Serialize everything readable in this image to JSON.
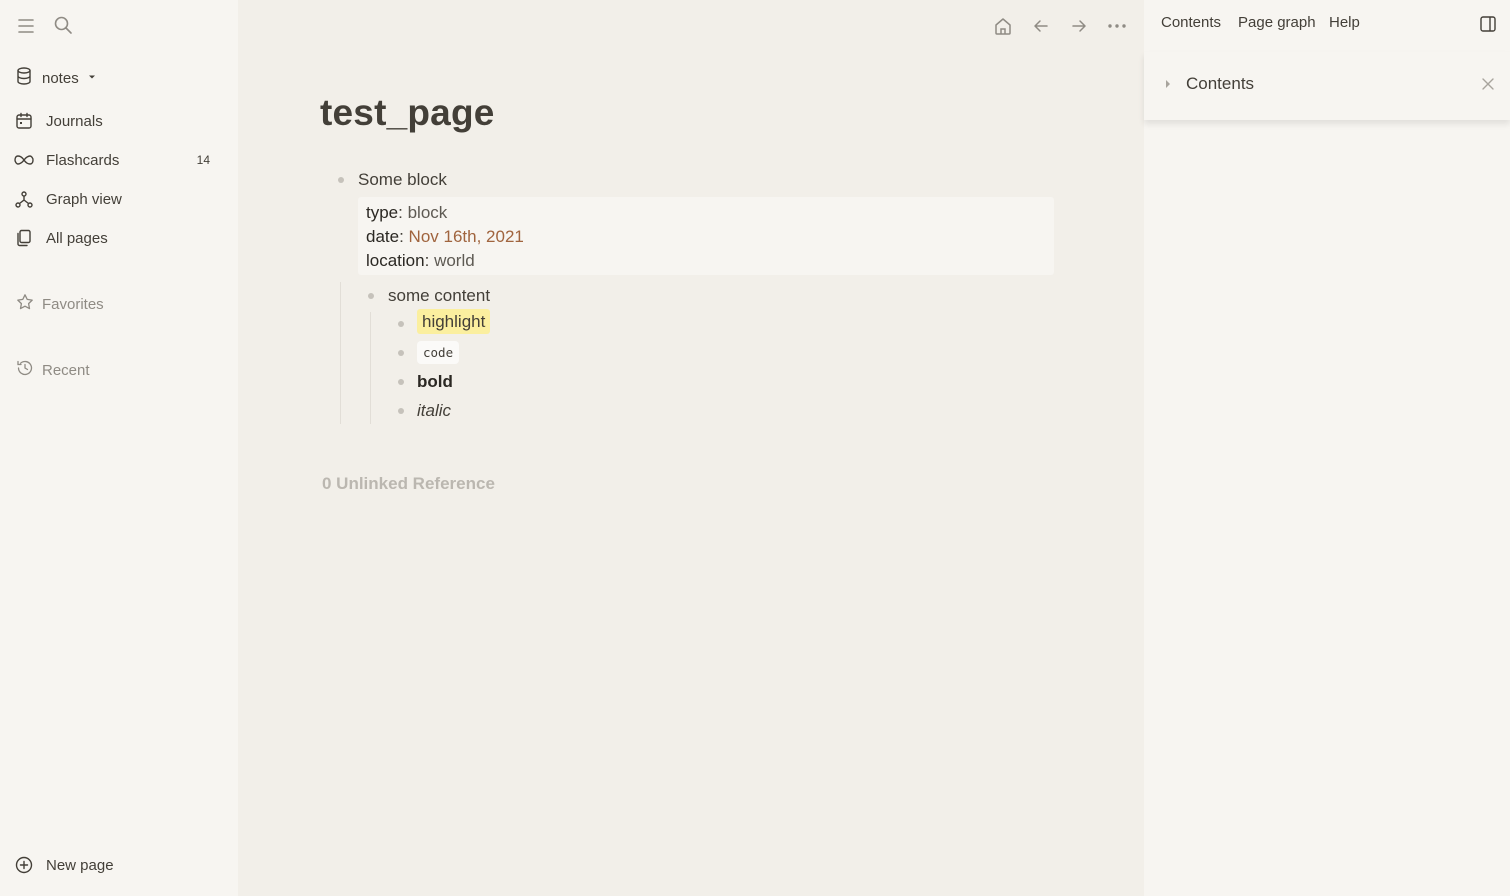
{
  "left_sidebar": {
    "graph_name": "notes",
    "nav": [
      {
        "label": "Journals"
      },
      {
        "label": "Flashcards",
        "count": "14"
      },
      {
        "label": "Graph view"
      },
      {
        "label": "All pages"
      }
    ],
    "favorites_label": "Favorites",
    "recent_label": "Recent",
    "new_page_label": "New page"
  },
  "page": {
    "title": "test_page",
    "block_text": "Some block",
    "properties": [
      {
        "key": "type",
        "value": "block"
      },
      {
        "key": "date",
        "value": "Nov 16th, 2021"
      },
      {
        "key": "location",
        "value": "world"
      }
    ],
    "child_text": "some content",
    "children": [
      "highlight",
      "code",
      "bold",
      "italic"
    ],
    "unlinked_label": "0 Unlinked Reference"
  },
  "right_sidebar": {
    "tabs": [
      "Contents",
      "Page graph",
      "Help"
    ],
    "panel_title": "Contents"
  },
  "colors": {
    "accent_date": "#a0643e",
    "highlight": "#fbef9f"
  }
}
